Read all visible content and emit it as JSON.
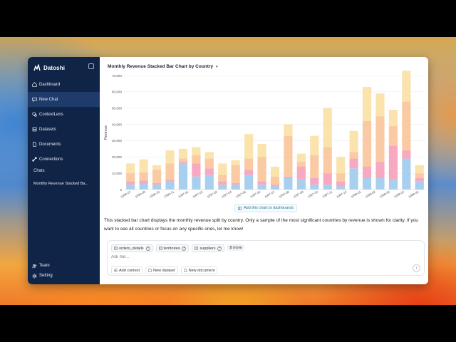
{
  "app": {
    "name": "Datoshi"
  },
  "sidebar": {
    "items": [
      {
        "label": "Dashboard",
        "icon": "home-icon"
      },
      {
        "label": "New Chat",
        "icon": "chat-icon",
        "active": true
      },
      {
        "label": "ContextLens",
        "icon": "lens-icon"
      },
      {
        "label": "Datasets",
        "icon": "dataset-icon"
      },
      {
        "label": "Documents",
        "icon": "document-icon"
      },
      {
        "label": "Connections",
        "icon": "link-icon"
      }
    ],
    "chats_heading": "Chats",
    "chats": [
      "Monthly Revenue Stacked Ba..."
    ],
    "bottom": [
      {
        "label": "Team",
        "icon": "team-icon"
      },
      {
        "label": "Setting",
        "icon": "gear-icon"
      }
    ]
  },
  "chart_panel": {
    "title": "Monthly Revenue Stacked Bar Chart by Country",
    "add_to_dashboard": "Add this chart to dashboards"
  },
  "chart_data": {
    "type": "bar",
    "stacked": true,
    "title": "Monthly Revenue Stacked Bar Chart by Country",
    "ylabel": "Revenue",
    "xlabel": "",
    "ylim": [
      0,
      70000
    ],
    "yticks": [
      0,
      10000,
      20000,
      30000,
      40000,
      50000,
      60000,
      70000
    ],
    "ytick_labels": [
      "0",
      "10,000",
      "20,000",
      "30,000",
      "40,000",
      "50,000",
      "60,000",
      "70,000"
    ],
    "grid": true,
    "categories": [
      "1996-07",
      "1996-08",
      "1996-09",
      "1996-10",
      "1996-11",
      "1996-12",
      "1997-01",
      "1997-02",
      "1997-03",
      "1997-04",
      "1997-05",
      "1997-06",
      "1997-07",
      "1997-08",
      "1997-09",
      "1997-10",
      "1997-11",
      "1997-12",
      "1998-01",
      "1998-02",
      "1998-03",
      "1998-04",
      "1998-05"
    ],
    "xtick_labels": [
      "1996-07",
      "1996-09",
      "1996-10",
      "1996-11",
      "1997-01",
      "1997-02",
      "1997-03",
      "1997-04",
      "1997-05",
      "1997-06",
      "1997-07",
      "1997-08",
      "1997-09",
      "1997-10",
      "1997-11",
      "1997-12",
      "1998-01",
      "1998-02",
      "1998-03",
      "1998-04",
      "1998-05"
    ],
    "colors": [
      "#a9cfef",
      "#f6a9c0",
      "#f9caa3",
      "#fae3ac"
    ],
    "series": [
      {
        "values": [
          3000,
          3500,
          3000,
          5000,
          16000,
          8000,
          9000,
          3000,
          3000,
          9000,
          3000,
          2000,
          7000,
          6000,
          3000,
          3000,
          2000,
          13000,
          7000,
          7000,
          6000,
          19000,
          5000
        ]
      },
      {
        "values": [
          2000,
          2000,
          1000,
          1000,
          1000,
          8000,
          4000,
          2000,
          1000,
          3000,
          2000,
          1000,
          1000,
          8000,
          4000,
          7000,
          3000,
          6000,
          7000,
          10000,
          21000,
          5000,
          2000
        ]
      },
      {
        "values": [
          5000,
          5000,
          8000,
          10000,
          2000,
          5000,
          6000,
          4000,
          11000,
          7000,
          15000,
          5000,
          25000,
          3000,
          14000,
          16000,
          5000,
          4000,
          28000,
          28000,
          12000,
          30000,
          3000
        ]
      },
      {
        "values": [
          6000,
          8000,
          3000,
          8000,
          6000,
          5000,
          4000,
          7000,
          3000,
          15000,
          8000,
          6000,
          7000,
          5000,
          12000,
          24000,
          10000,
          13000,
          21000,
          14000,
          10000,
          19000,
          5000
        ]
      }
    ]
  },
  "message": {
    "text": "This stacked bar chart displays the monthly revenue split by country. Only a sample of the most significant countries by revenue is shown for clarity. If you want to see all countries or focus on any specific ones, let me know!"
  },
  "composer": {
    "chips": [
      "orders_details",
      "territories",
      "suppliers"
    ],
    "more": "8 more",
    "placeholder": "Ask me...",
    "actions": [
      "Add context",
      "New dataset",
      "New document"
    ]
  }
}
